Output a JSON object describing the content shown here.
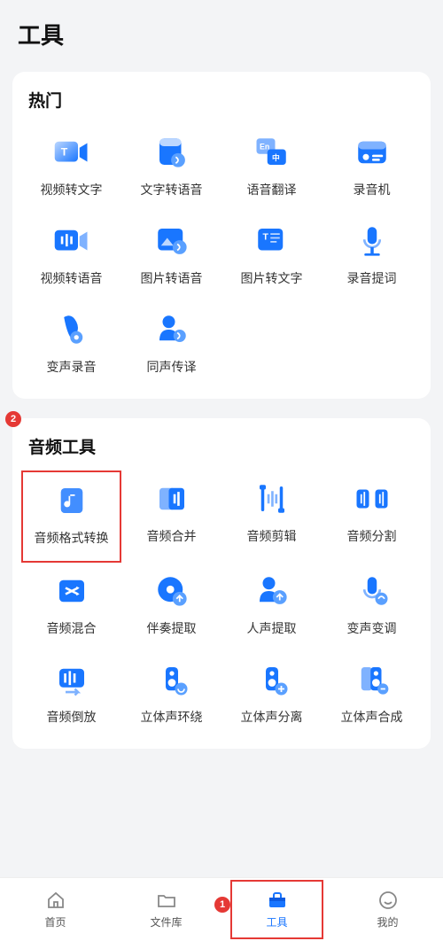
{
  "page_title": "工具",
  "sections": [
    {
      "title": "热门",
      "name": "section-hot",
      "tools": [
        {
          "label": "视频转文字",
          "icon": "video-to-text-icon"
        },
        {
          "label": "文字转语音",
          "icon": "text-to-speech-icon"
        },
        {
          "label": "语音翻译",
          "icon": "voice-translate-icon"
        },
        {
          "label": "录音机",
          "icon": "recorder-icon"
        },
        {
          "label": "视频转语音",
          "icon": "video-to-speech-icon"
        },
        {
          "label": "图片转语音",
          "icon": "image-to-speech-icon"
        },
        {
          "label": "图片转文字",
          "icon": "image-to-text-icon"
        },
        {
          "label": "录音提词",
          "icon": "voice-teleprompter-icon"
        },
        {
          "label": "变声录音",
          "icon": "voice-change-record-icon"
        },
        {
          "label": "同声传译",
          "icon": "simultaneous-interpret-icon"
        }
      ]
    },
    {
      "title": "音频工具",
      "name": "section-audio",
      "tools": [
        {
          "label": "音频格式转换",
          "icon": "audio-format-icon",
          "highlighted": true
        },
        {
          "label": "音频合并",
          "icon": "audio-merge-icon"
        },
        {
          "label": "音频剪辑",
          "icon": "audio-trim-icon"
        },
        {
          "label": "音频分割",
          "icon": "audio-split-icon"
        },
        {
          "label": "音频混合",
          "icon": "audio-mix-icon"
        },
        {
          "label": "伴奏提取",
          "icon": "accompaniment-extract-icon"
        },
        {
          "label": "人声提取",
          "icon": "vocal-extract-icon"
        },
        {
          "label": "变声变调",
          "icon": "pitch-shift-icon"
        },
        {
          "label": "音频倒放",
          "icon": "audio-reverse-icon"
        },
        {
          "label": "立体声环绕",
          "icon": "stereo-surround-icon"
        },
        {
          "label": "立体声分离",
          "icon": "stereo-split-icon"
        },
        {
          "label": "立体声合成",
          "icon": "stereo-merge-icon"
        }
      ]
    }
  ],
  "tabbar": {
    "items": [
      {
        "label": "首页",
        "icon": "home-icon",
        "active": false
      },
      {
        "label": "文件库",
        "icon": "folder-icon",
        "active": false
      },
      {
        "label": "工具",
        "icon": "toolbox-icon",
        "active": true,
        "highlighted": true
      },
      {
        "label": "我的",
        "icon": "profile-icon",
        "active": false
      }
    ]
  },
  "annotations": {
    "1": {
      "attached_to": "tabbar.tools"
    },
    "2": {
      "attached_to": "audio.format_convert"
    }
  },
  "colors": {
    "accent": "#1976ff",
    "accent_light": "#7fb2ff",
    "highlight": "#e53935",
    "bg": "#f3f4f6"
  }
}
